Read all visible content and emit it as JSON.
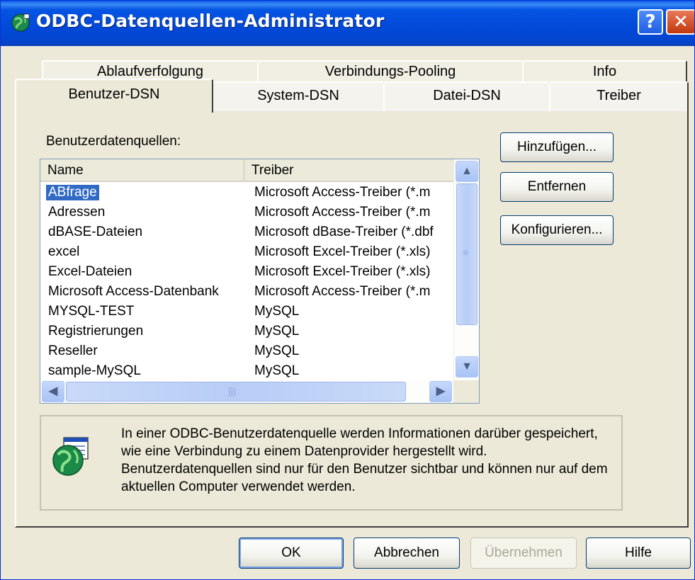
{
  "window": {
    "title": "ODBC-Datenquellen-Administrator",
    "help_label": "?",
    "close_label": "✕"
  },
  "tabs": {
    "back_row": [
      "Ablaufverfolgung",
      "Verbindungs-Pooling",
      "Info"
    ],
    "front_row": [
      "Benutzer-DSN",
      "System-DSN",
      "Datei-DSN",
      "Treiber"
    ],
    "active": "Benutzer-DSN"
  },
  "panel": {
    "list_label": "Benutzerdatenquellen:",
    "columns": [
      "Name",
      "Treiber"
    ],
    "rows": [
      {
        "name": "ABfrage",
        "driver": "Microsoft Access-Treiber (*.m",
        "selected": true
      },
      {
        "name": "Adressen",
        "driver": "Microsoft Access-Treiber (*.m"
      },
      {
        "name": "dBASE-Dateien",
        "driver": "Microsoft dBase-Treiber (*.dbf"
      },
      {
        "name": "excel",
        "driver": "Microsoft Excel-Treiber (*.xls)"
      },
      {
        "name": "Excel-Dateien",
        "driver": "Microsoft Excel-Treiber (*.xls)"
      },
      {
        "name": "Microsoft Access-Datenbank",
        "driver": "Microsoft Access-Treiber (*.m"
      },
      {
        "name": "MYSQL-TEST",
        "driver": "MySQL"
      },
      {
        "name": "Registrierungen",
        "driver": "MySQL"
      },
      {
        "name": "Reseller",
        "driver": "MySQL"
      },
      {
        "name": "sample-MySQL",
        "driver": "MySQL"
      }
    ],
    "buttons": {
      "add": "Hinzufügen...",
      "remove": "Entfernen",
      "configure": "Konfigurieren..."
    },
    "info_text": "In einer ODBC-Benutzerdatenquelle werden Informationen darüber gespeichert, wie eine Verbindung zu einem Datenprovider hergestellt wird. Benutzerdatenquellen sind nur für den Benutzer sichtbar und können nur auf dem aktuellen Computer verwendet werden."
  },
  "footer": {
    "ok": "OK",
    "cancel": "Abbrechen",
    "apply": "Übernehmen",
    "help": "Hilfe"
  },
  "colors": {
    "titlebar": "#0249d8",
    "selection": "#316ac5",
    "face": "#ece9d8"
  }
}
